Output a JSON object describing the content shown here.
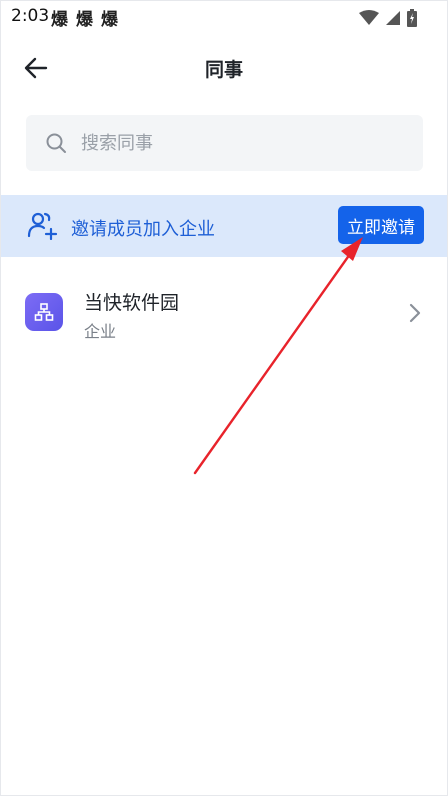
{
  "status_bar": {
    "time": "2:03",
    "notification_glyphs": [
      "爆",
      "爆",
      "爆"
    ],
    "icons": [
      "wifi-icon",
      "signal-icon",
      "battery-icon"
    ]
  },
  "header": {
    "title": "同事",
    "back_icon": "arrow-left-icon"
  },
  "search": {
    "placeholder": "搜索同事",
    "value": "",
    "icon": "search-icon"
  },
  "invite_banner": {
    "text": "邀请成员加入企业",
    "button_label": "立即邀请",
    "icon": "add-people-icon"
  },
  "company": {
    "name": "当快软件园",
    "type": "企业",
    "icon": "org-chart-icon"
  },
  "colors": {
    "accent": "#1463ea",
    "banner_bg": "#dbe8fb",
    "banner_text": "#1e5fd6",
    "search_bg": "#f3f5f7",
    "avatar": "#6b5ff0",
    "annotation": "#e8232b"
  }
}
